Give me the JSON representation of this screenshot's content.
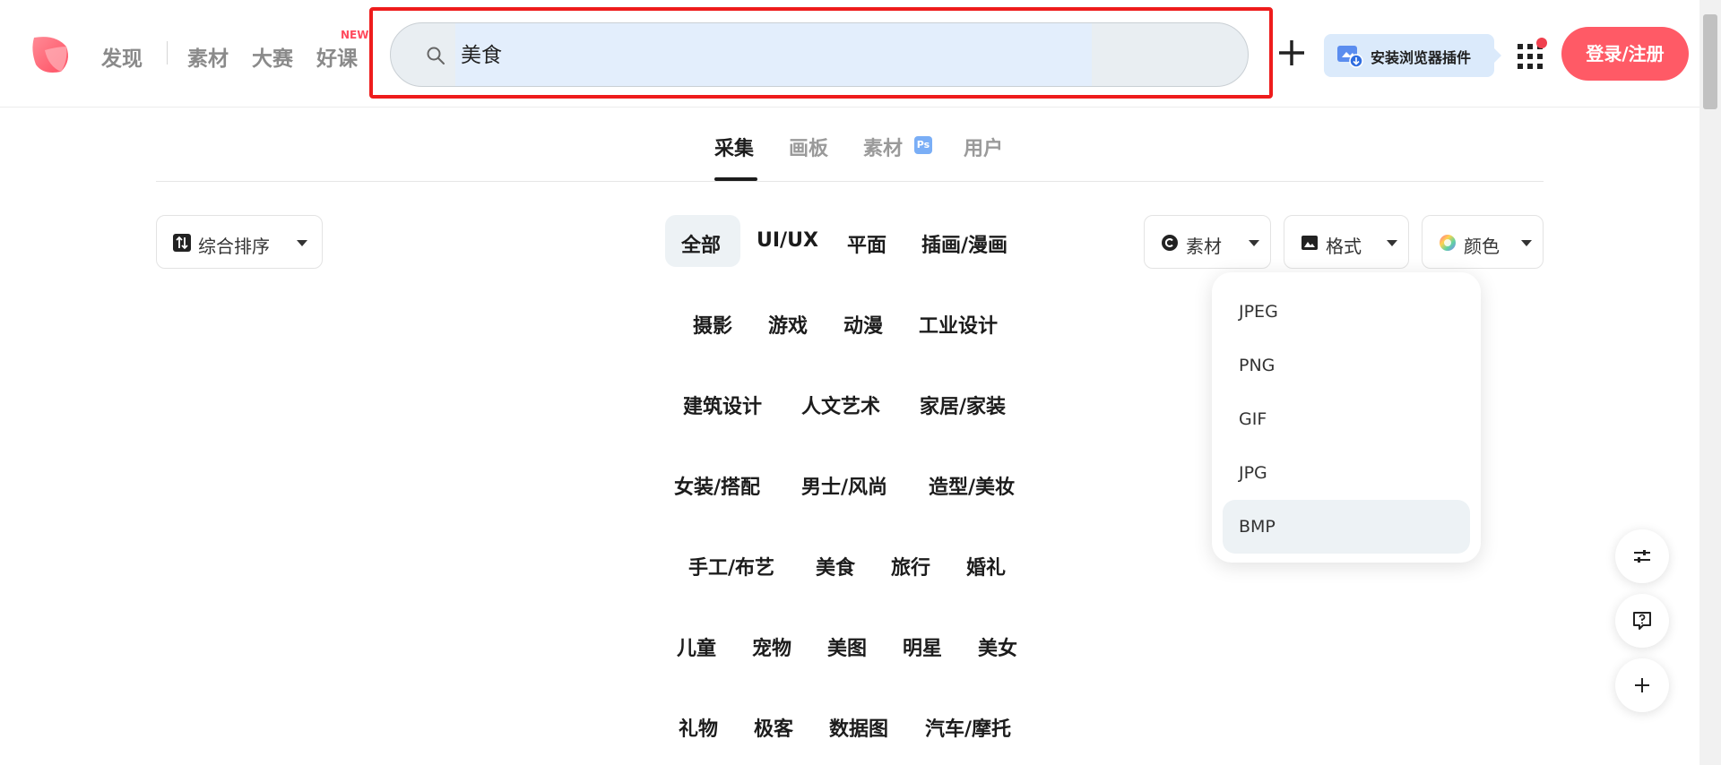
{
  "header": {
    "nav": [
      "发现",
      "素材",
      "大赛",
      "好课"
    ],
    "new_badge": "NEW",
    "search": {
      "value": "美食",
      "icon": "search-icon"
    },
    "plugin_label": "安装浏览器插件",
    "login_label": "登录/注册",
    "accent_color": "#ff5a66"
  },
  "tabs": [
    "采集",
    "画板",
    "素材",
    "用户"
  ],
  "ps_badge": "Ps",
  "sort": {
    "label": "综合排序"
  },
  "categories": [
    [
      "全部",
      "UI/UX",
      "平面",
      "插画/漫画"
    ],
    [
      "摄影",
      "游戏",
      "动漫",
      "工业设计"
    ],
    [
      "建筑设计",
      "人文艺术",
      "家居/家装"
    ],
    [
      "女装/搭配",
      "男士/风尚",
      "造型/美妆"
    ],
    [
      "手工/布艺",
      "美食",
      "旅行",
      "婚礼"
    ],
    [
      "儿童",
      "宠物",
      "美图",
      "明星",
      "美女"
    ],
    [
      "礼物",
      "极客",
      "数据图",
      "汽车/摩托"
    ]
  ],
  "filters": {
    "material": "素材",
    "format": "格式",
    "color": "颜色"
  },
  "format_options": [
    "JPEG",
    "PNG",
    "GIF",
    "JPG",
    "BMP"
  ]
}
